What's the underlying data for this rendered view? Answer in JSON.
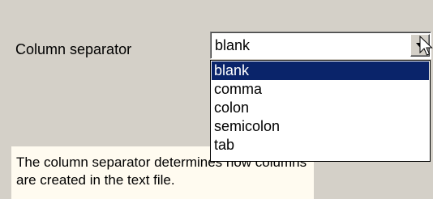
{
  "column_separator": {
    "label": "Column separator",
    "selected_value": "blank",
    "options": [
      "blank",
      "comma",
      "colon",
      "semicolon",
      "tab"
    ],
    "highlighted_index": 0
  },
  "info": {
    "text": "The column separator determines how columns are created in the text file."
  },
  "icons": {
    "dropdown_arrow": "chevron-down-icon",
    "cursor": "mouse-pointer-icon"
  },
  "colors": {
    "background": "#d4d0c8",
    "highlight": "#0a246a",
    "info_background": "#fffbf0"
  }
}
